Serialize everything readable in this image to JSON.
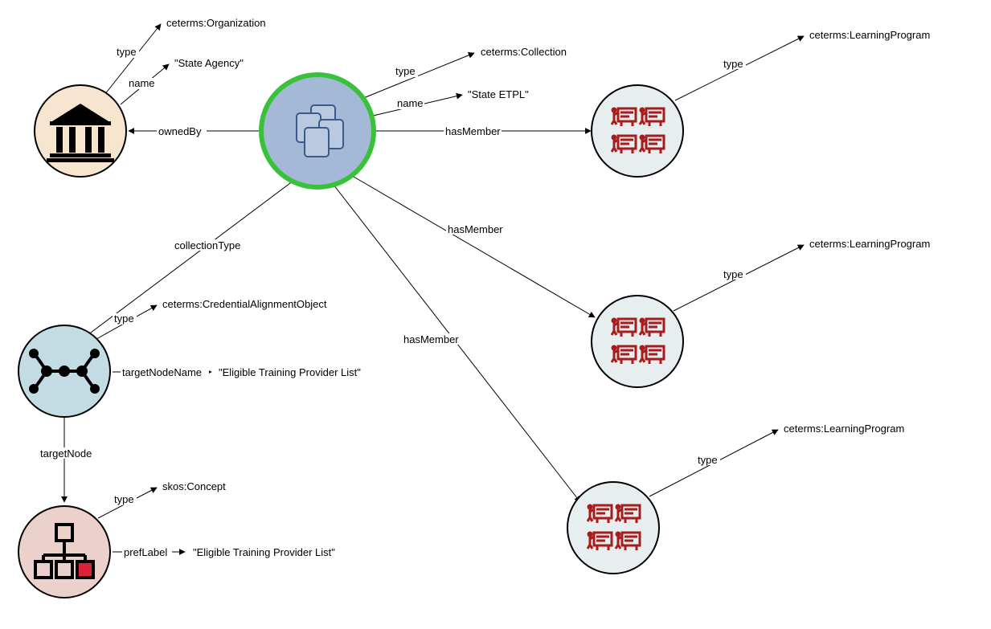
{
  "nodes": {
    "organization": {
      "fill": "#f7e5cf"
    },
    "collection": {
      "fill": "#a3b9d6",
      "ring": "#3ac13a"
    },
    "alignment": {
      "fill": "#c3dce4"
    },
    "concept": {
      "fill": "#ecd0cc"
    },
    "program": {
      "fill": "#e6eef0"
    }
  },
  "labels": {
    "org_type": "ceterms:Organization",
    "org_name": "\"State Agency\"",
    "ownedBy": "ownedBy",
    "coll_type": "ceterms:Collection",
    "coll_name": "\"State ETPL\"",
    "hasMember": "hasMember",
    "collectionType": "collectionType",
    "align_type": "ceterms:CredentialAlignmentObject",
    "targetNodeName": "targetNodeName",
    "tnn_value": "\"Eligible Training Provider List\"",
    "targetNode": "targetNode",
    "concept_type": "skos:Concept",
    "prefLabel": "prefLabel",
    "prefLabel_value": "\"Eligible Training Provider List\"",
    "prog_type": "ceterms:LearningProgram",
    "type": "type",
    "name": "name"
  }
}
